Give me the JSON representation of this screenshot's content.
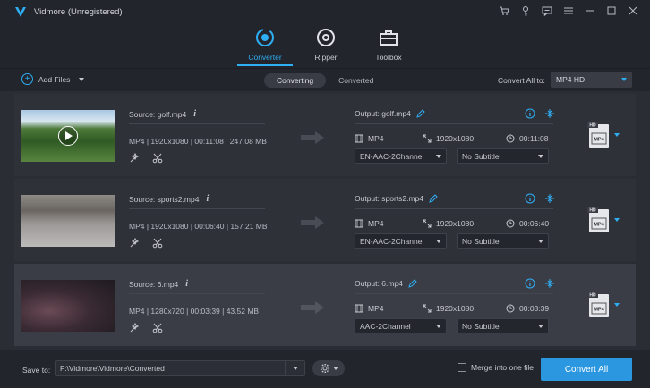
{
  "window": {
    "title": "Vidmore (Unregistered)"
  },
  "tabs": [
    {
      "label": "Converter",
      "active": true
    },
    {
      "label": "Ripper",
      "active": false
    },
    {
      "label": "Toolbox",
      "active": false
    }
  ],
  "toolbar": {
    "add_files": "Add Files",
    "seg_converting": "Converting",
    "seg_converted": "Converted",
    "convert_all_to": "Convert All to:",
    "convert_all_format": "MP4 HD"
  },
  "files": [
    {
      "source": "Source: golf.mp4",
      "meta": "MP4 | 1920x1080 | 00:11:08 | 247.08 MB",
      "output": "Output: golf.mp4",
      "out_format": "MP4",
      "out_res": "1920x1080",
      "out_dur": "00:11:08",
      "audio": "EN-AAC-2Channel",
      "subtitle": "No Subtitle"
    },
    {
      "source": "Source: sports2.mp4",
      "meta": "MP4 | 1920x1080 | 00:06:40 | 157.21 MB",
      "output": "Output: sports2.mp4",
      "out_format": "MP4",
      "out_res": "1920x1080",
      "out_dur": "00:06:40",
      "audio": "EN-AAC-2Channel",
      "subtitle": "No Subtitle"
    },
    {
      "source": "Source: 6.mp4",
      "meta": "MP4 | 1280x720 | 00:03:39 | 43.52 MB",
      "output": "Output: 6.mp4",
      "out_format": "MP4",
      "out_res": "1920x1080",
      "out_dur": "00:03:39",
      "audio": "AAC-2Channel",
      "subtitle": "No Subtitle"
    }
  ],
  "format_badge": {
    "top": "HD",
    "bottom": "MP4"
  },
  "bottom": {
    "save_to": "Save to:",
    "path": "F:\\Vidmore\\Vidmore\\Converted",
    "merge": "Merge into one file",
    "convert_all": "Convert All"
  },
  "colors": {
    "accent": "#2eaef3",
    "button": "#2a97e0",
    "bg": "#2b2d35",
    "bar": "#23252d"
  }
}
